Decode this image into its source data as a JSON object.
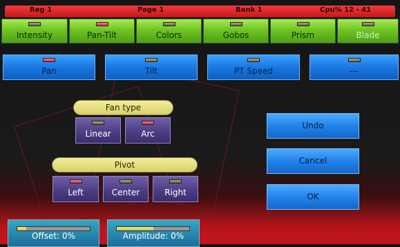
{
  "status_bar": {
    "reg": "Reg 1",
    "page": "Page 1",
    "bank": "Bank 1",
    "cpu": "Cpu% 12 - 41"
  },
  "category_tabs": [
    {
      "label": "Intensity",
      "led": "off"
    },
    {
      "label": "Pan-Tilt",
      "led": "on"
    },
    {
      "label": "Colors",
      "led": "off"
    },
    {
      "label": "Gobos",
      "led": "off"
    },
    {
      "label": "Prism",
      "led": "off"
    },
    {
      "label": "Blade",
      "led": "off"
    }
  ],
  "parameter_tabs": [
    {
      "label": "Pan",
      "led": "on"
    },
    {
      "label": "Tilt",
      "led": "off"
    },
    {
      "label": "PT Speed",
      "led": "off"
    },
    {
      "label": "---",
      "led": "off"
    }
  ],
  "fan_type": {
    "title": "Fan type",
    "options": [
      {
        "label": "Linear",
        "led": "off"
      },
      {
        "label": "Arc",
        "led": "on"
      }
    ]
  },
  "pivot": {
    "title": "Pivot",
    "options": [
      {
        "label": "Left",
        "led": "on"
      },
      {
        "label": "Center",
        "led": "off"
      },
      {
        "label": "Right",
        "led": "off"
      }
    ]
  },
  "actions": {
    "undo": "Undo",
    "cancel": "Cancel",
    "ok": "OK"
  },
  "faders": {
    "offset": {
      "label": "Offset: 0%",
      "level": 0.12
    },
    "amplitude": {
      "label": "Amplitude: 0%",
      "level": 0.5
    }
  },
  "colors": {
    "led_on": "#d8284b",
    "led_off": "#6e6342",
    "category_green": "#6fc424",
    "parameter_blue": "#1a77e2",
    "option_purple": "#4b3c82",
    "header_yellow": "#d8d06a",
    "status_red": "#c8161b"
  }
}
